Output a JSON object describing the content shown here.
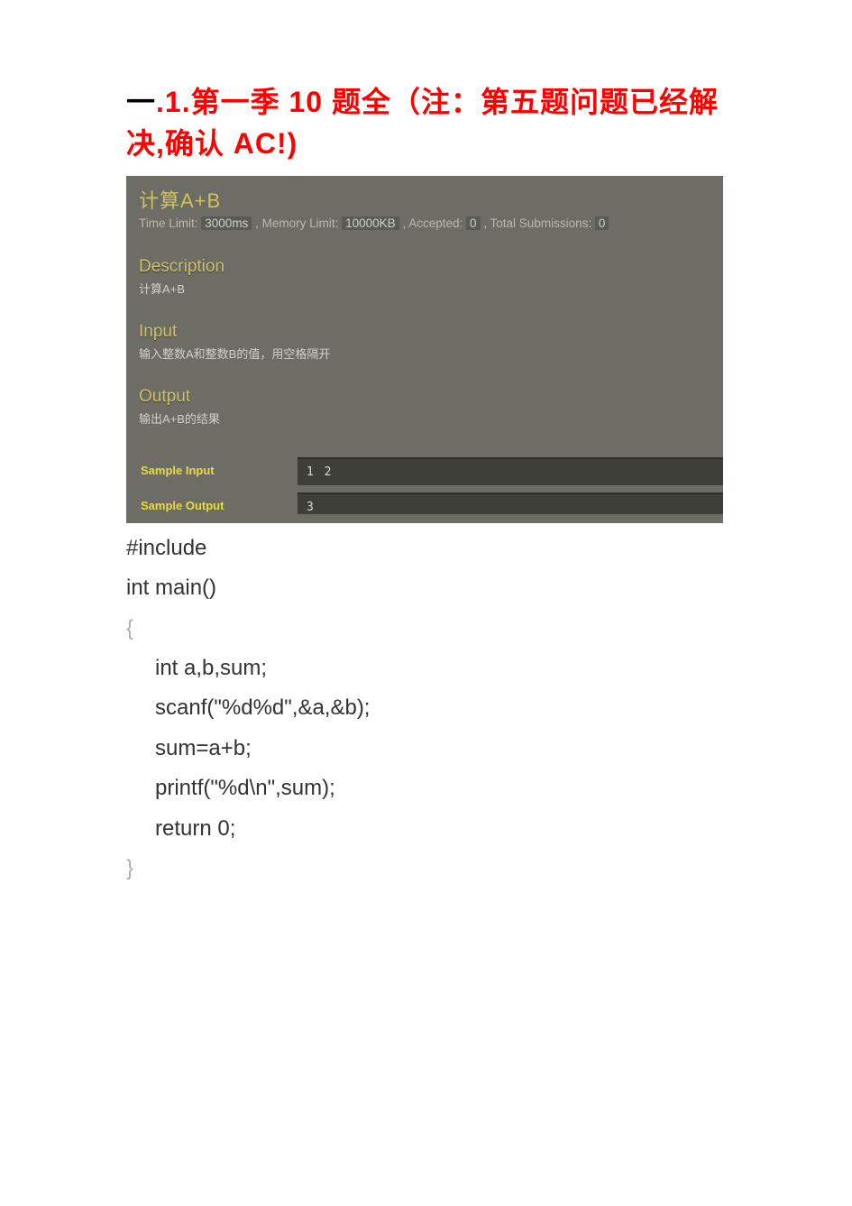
{
  "title": {
    "prefix_black": "一",
    "rest": ".1.第一季 10 题全（注：第五题问题已经解决,确认 AC!)"
  },
  "problem": {
    "name": "计算A+B",
    "meta": {
      "time_label": "Time Limit:",
      "time_value": "3000ms",
      "mem_label": ", Memory Limit:",
      "mem_value": "10000KB",
      "acc_label": ", Accepted:",
      "acc_value": "0",
      "sub_label": ", Total Submissions:",
      "sub_value": "0"
    },
    "description": {
      "head": "Description",
      "body": "计算A+B"
    },
    "input": {
      "head": "Input",
      "body": "输入整数A和整数B的值，用空格隔开"
    },
    "output": {
      "head": "Output",
      "body": "输出A+B的结果"
    },
    "sample_input": {
      "label": "Sample Input",
      "value": "1 2"
    },
    "sample_output": {
      "label": "Sample Output",
      "value": "3"
    }
  },
  "code_lines": {
    "l1": "#include",
    "l2": "int  main()",
    "l3": "{",
    "l4": "int  a,b,sum;",
    "l5": "scanf(\"%d%d\",&a,&b);",
    "l6": "sum=a+b;",
    "l7": "printf(\"%d\\n\",sum);",
    "l8": "return  0;",
    "l9": "}"
  }
}
